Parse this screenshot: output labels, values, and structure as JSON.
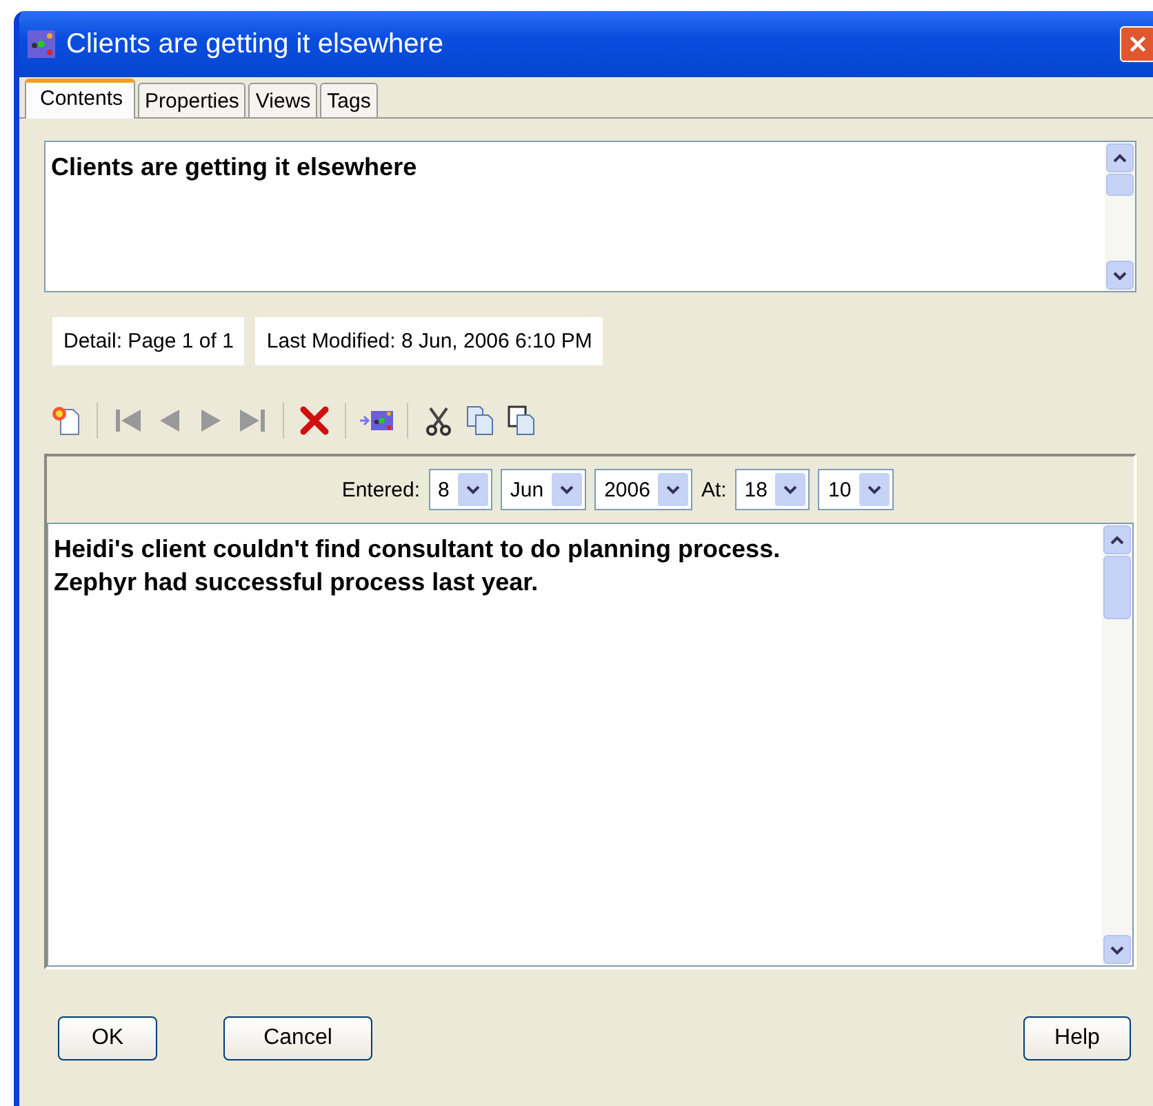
{
  "window": {
    "title": "Clients are getting it elsewhere"
  },
  "tabs": [
    {
      "label": "Contents",
      "selected": true
    },
    {
      "label": "Properties",
      "selected": false
    },
    {
      "label": "Views",
      "selected": false
    },
    {
      "label": "Tags",
      "selected": false
    }
  ],
  "title_field": {
    "value": "Clients are getting it elsewhere"
  },
  "info": [
    "Detail: Page 1 of 1",
    "Last Modified: 8 Jun, 2006 6:10 PM"
  ],
  "toolbar": [
    {
      "kind": "new"
    },
    {
      "kind": "separator"
    },
    {
      "kind": "first",
      "disabled": true
    },
    {
      "kind": "prev",
      "disabled": true
    },
    {
      "kind": "next",
      "disabled": true
    },
    {
      "kind": "last",
      "disabled": true
    },
    {
      "kind": "separator"
    },
    {
      "kind": "delete"
    },
    {
      "kind": "separator"
    },
    {
      "kind": "link"
    },
    {
      "kind": "separator"
    },
    {
      "kind": "cut"
    },
    {
      "kind": "copy"
    },
    {
      "kind": "paste"
    }
  ],
  "entered": {
    "label": "Entered:",
    "day": "8",
    "month": "Jun",
    "year": "2006",
    "at_label": "At:",
    "hour": "18",
    "minute": "10"
  },
  "notes": {
    "value": "Heidi's client couldn't find consultant to do planning process.\nZephyr had successful process last year."
  },
  "buttons": [
    {
      "label": "OK",
      "kind": "left"
    },
    {
      "label": "Cancel",
      "kind": "left"
    },
    {
      "label": "Help",
      "kind": "right"
    }
  ]
}
